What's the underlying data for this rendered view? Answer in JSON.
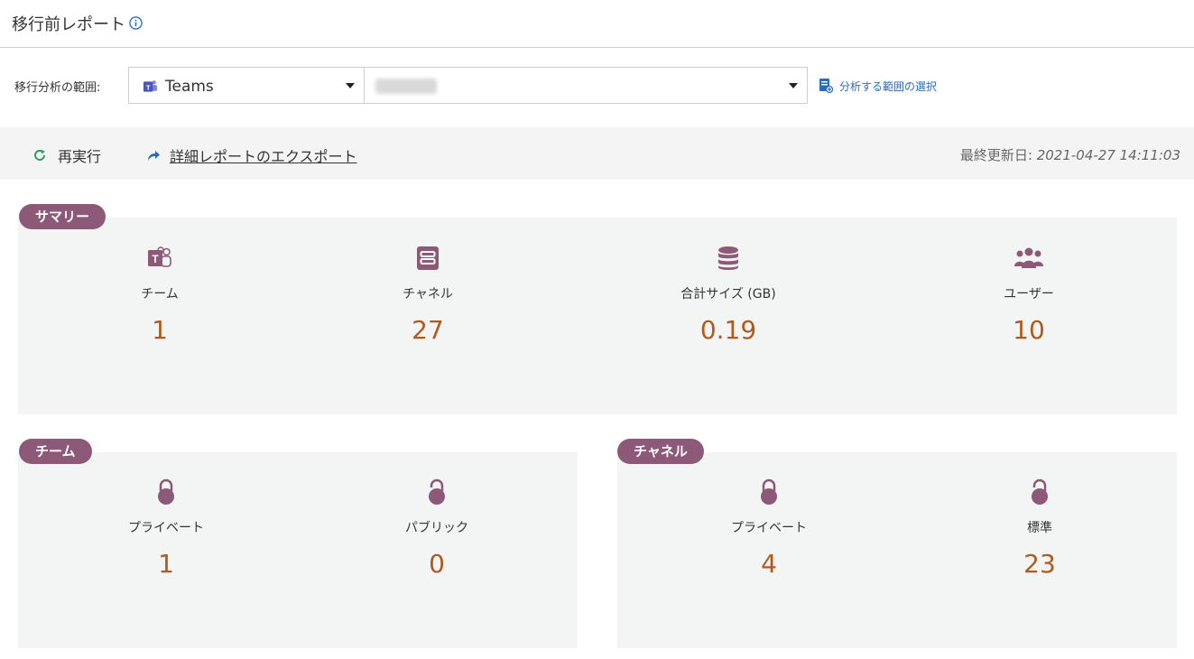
{
  "header": {
    "title": "移行前レポート",
    "info_icon": "info-icon"
  },
  "scope": {
    "label": "移行分析の範囲:",
    "app_select_value": "Teams",
    "app_icon": "teams-icon",
    "scope_link": "分析する範囲の選択"
  },
  "toolbar": {
    "rerun_label": "再実行",
    "export_label": "詳細レポートのエクスポート",
    "updated_label": "最終更新日:",
    "updated_value": "2021-04-27 14:11:03"
  },
  "summary": {
    "tag": "サマリー",
    "items": [
      {
        "icon": "teams-icon",
        "label": "チーム",
        "value": "1"
      },
      {
        "icon": "channel-icon",
        "label": "チャネル",
        "value": "27"
      },
      {
        "icon": "database-icon",
        "label": "合計サイズ (GB)",
        "value": "0.19"
      },
      {
        "icon": "users-icon",
        "label": "ユーザー",
        "value": "10"
      }
    ]
  },
  "team": {
    "tag": "チーム",
    "items": [
      {
        "icon": "lock-icon",
        "label": "プライベート",
        "value": "1"
      },
      {
        "icon": "unlock-icon",
        "label": "パブリック",
        "value": "0"
      }
    ]
  },
  "channel": {
    "tag": "チャネル",
    "items": [
      {
        "icon": "lock-icon",
        "label": "プライベート",
        "value": "4"
      },
      {
        "icon": "unlock-icon",
        "label": "標準",
        "value": "23"
      }
    ]
  },
  "colors": {
    "accent": "#8c5a78",
    "value": "#b05a1e",
    "link": "#2b6cb8",
    "panel": "#f3f5f4"
  }
}
